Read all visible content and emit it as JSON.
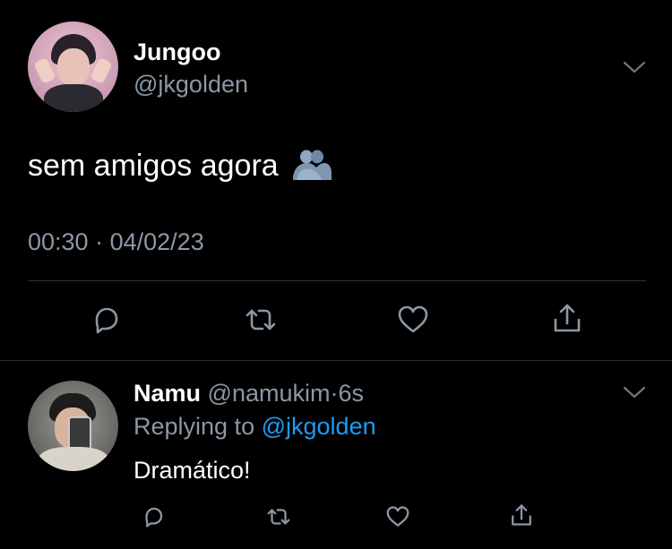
{
  "main_tweet": {
    "author_name": "Jungoo",
    "author_handle": "@jkgolden",
    "text": "sem amigos agora",
    "emoji_icon": "hugging-people-icon",
    "time": "00:30",
    "separator": "·",
    "date": "04/02/23",
    "actions": [
      "reply-icon",
      "retweet-icon",
      "like-icon",
      "share-icon"
    ]
  },
  "reply_tweet": {
    "author_name": "Namu",
    "author_handle": "@namukim",
    "separator": "·",
    "age": "6s",
    "replying_label": "Replying to",
    "replying_to": "@jkgolden",
    "text": "Dramático!",
    "actions": [
      "reply-icon",
      "retweet-icon",
      "like-icon",
      "share-icon"
    ]
  },
  "colors": {
    "background": "#000000",
    "text_primary": "#ffffff",
    "text_secondary": "#8b98a5",
    "link": "#1d9bf0",
    "divider": "#2f3336"
  }
}
